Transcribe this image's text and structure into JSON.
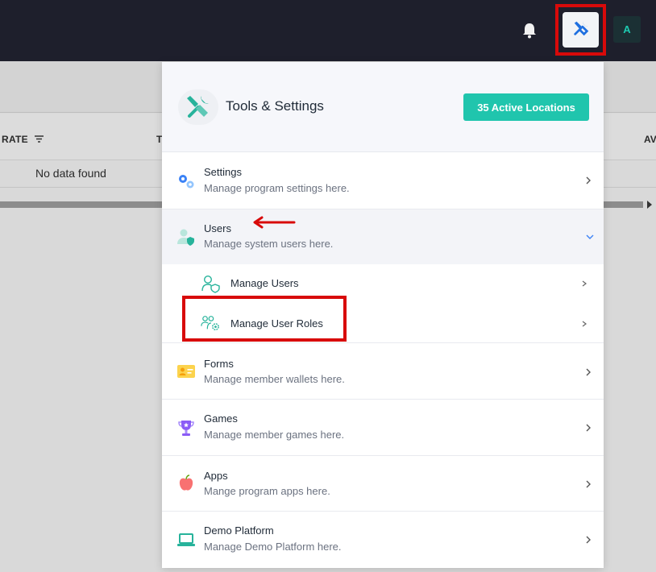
{
  "topbar": {
    "avatar_initial": "A",
    "bell_icon": "bell-icon",
    "tools_icon": "tools-icon"
  },
  "background": {
    "col_rate": "RATE",
    "col_t": "T",
    "col_av": "AV",
    "empty_message": "No data found"
  },
  "panel": {
    "title": "Tools & Settings",
    "active_locations_button": "35 Active Locations",
    "items": [
      {
        "title": "Settings",
        "subtitle": "Manage program settings here.",
        "icon": "gears-icon"
      },
      {
        "title": "Users",
        "subtitle": "Manage system users here.",
        "icon": "user-shield-icon"
      },
      {
        "title": "Forms",
        "subtitle": "Manage member wallets here.",
        "icon": "id-card-icon"
      },
      {
        "title": "Games",
        "subtitle": "Manage member games here.",
        "icon": "trophy-icon"
      },
      {
        "title": "Apps",
        "subtitle": "Mange program apps here.",
        "icon": "apple-icon"
      },
      {
        "title": "Demo Platform",
        "subtitle": "Manage Demo Platform here.",
        "icon": "laptop-icon"
      }
    ],
    "users_subitems": [
      {
        "label": "Manage Users",
        "icon": "user-shield-outline-icon"
      },
      {
        "label": "Manage User Roles",
        "icon": "users-gear-icon"
      }
    ]
  },
  "colors": {
    "accent": "#20c5ad",
    "topbar": "#1e1f2c",
    "annotation_red": "#d80a0a"
  }
}
